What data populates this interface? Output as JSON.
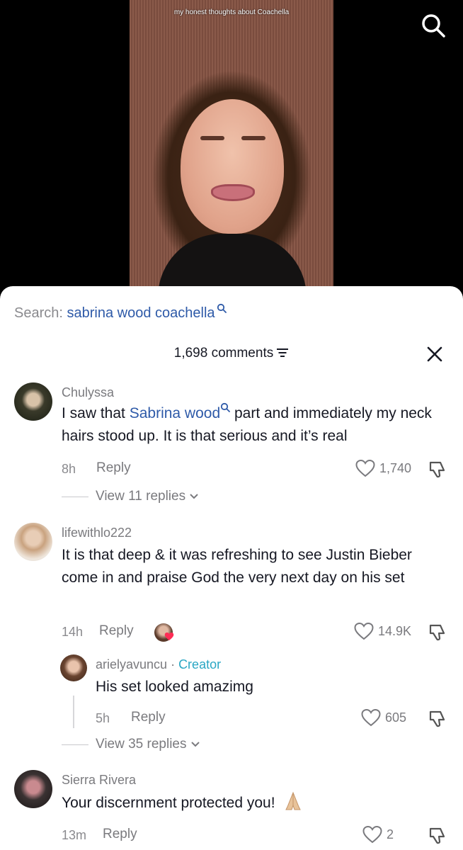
{
  "video": {
    "caption": "my honest thoughts about Coachella"
  },
  "search": {
    "prefix": "Search:",
    "query": "sabrina wood coachella"
  },
  "comments_header": {
    "count_label": "1,698 comments"
  },
  "comments": [
    {
      "username": "Chulyssa",
      "text_before": "I saw that ",
      "text_link": "Sabrina wood",
      "text_after": " part and immediately my neck hairs stood up. It is that serious and it’s real",
      "time": "8h",
      "reply_label": "Reply",
      "likes": "1,740",
      "view_replies": "View 11 replies"
    },
    {
      "username": "lifewithlo222",
      "text": "It is that deep & it was refreshing to see Justin Bieber come in and praise God the very next day on his set",
      "time": "14h",
      "reply_label": "Reply",
      "likes": "14.9K",
      "view_replies": "View 35 replies",
      "reply": {
        "username": "arielyavuncu",
        "separator": " · ",
        "badge": "Creator",
        "text": "His set looked amazimg",
        "time": "5h",
        "reply_label": "Reply",
        "likes": "605"
      }
    },
    {
      "username": "Sierra Rivera",
      "text": "Your discernment protected you!",
      "time": "13m",
      "reply_label": "Reply",
      "likes": "2"
    }
  ],
  "colors": {
    "link": "#2e5aa8",
    "creator_badge": "#2aa7c4",
    "secondary_text": "#7a7a7e"
  },
  "icons": [
    "search-icon",
    "filter-icon",
    "close-icon",
    "heart-icon",
    "dislike-icon",
    "chevron-down-icon",
    "praying-hands-emoji"
  ]
}
